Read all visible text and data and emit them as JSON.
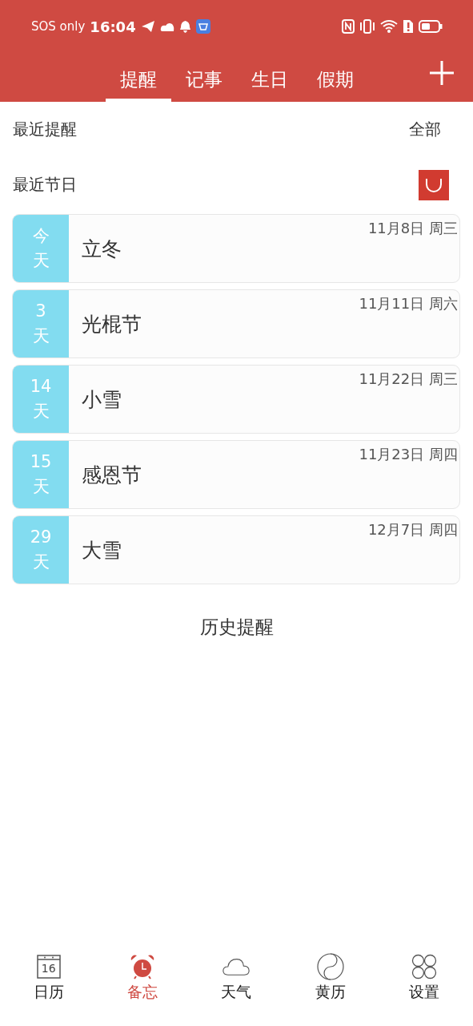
{
  "status_bar": {
    "carrier": "SOS only",
    "time": "16:04"
  },
  "tabs": [
    {
      "label": "提醒",
      "selected": true
    },
    {
      "label": "记事",
      "selected": false
    },
    {
      "label": "生日",
      "selected": false
    },
    {
      "label": "假期",
      "selected": false
    }
  ],
  "recent_reminders": {
    "title": "最近提醒",
    "action": "全部"
  },
  "recent_holidays": {
    "title": "最近节日"
  },
  "holidays": [
    {
      "count": "今",
      "unit": "天",
      "name": "立冬",
      "date": "11月8日 周三"
    },
    {
      "count": "3",
      "unit": "天",
      "name": "光棍节",
      "date": "11月11日 周六"
    },
    {
      "count": "14",
      "unit": "天",
      "name": "小雪",
      "date": "11月22日 周三"
    },
    {
      "count": "15",
      "unit": "天",
      "name": "感恩节",
      "date": "11月23日 周四"
    },
    {
      "count": "29",
      "unit": "天",
      "name": "大雪",
      "date": "12月7日 周四"
    }
  ],
  "history_link": "历史提醒",
  "bottom_nav": [
    {
      "kind": "calendar",
      "label": "日历",
      "icon_text": "16",
      "selected": false
    },
    {
      "kind": "alarm",
      "label": "备忘",
      "selected": true
    },
    {
      "kind": "weather",
      "label": "天气",
      "selected": false
    },
    {
      "kind": "almanac",
      "label": "黄历",
      "selected": false
    },
    {
      "kind": "settings",
      "label": "设置",
      "selected": false
    }
  ]
}
